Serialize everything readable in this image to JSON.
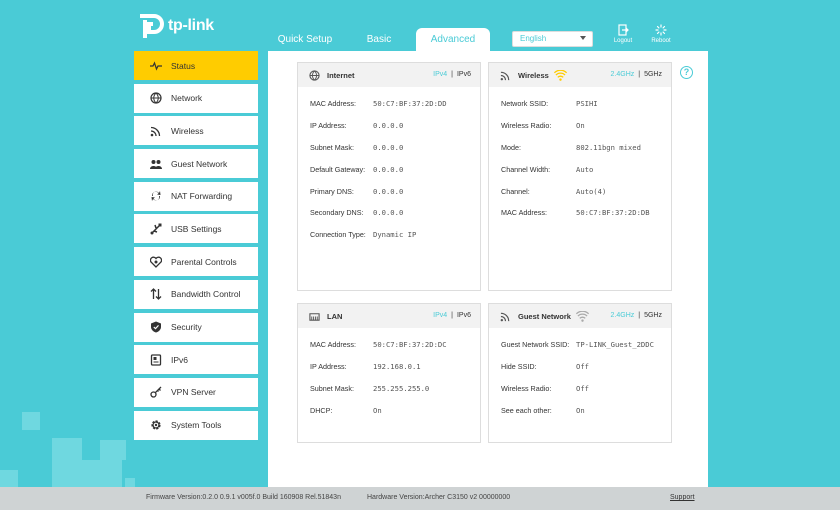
{
  "brand": {
    "logo_text": "tp-link"
  },
  "topnav": {
    "tabs": [
      "Quick Setup",
      "Basic",
      "Advanced"
    ],
    "language": "English",
    "logout_label": "Logout",
    "reboot_label": "Reboot"
  },
  "sidebar": {
    "items": [
      {
        "label": "Status"
      },
      {
        "label": "Network"
      },
      {
        "label": "Wireless"
      },
      {
        "label": "Guest Network"
      },
      {
        "label": "NAT Forwarding"
      },
      {
        "label": "USB Settings"
      },
      {
        "label": "Parental Controls"
      },
      {
        "label": "Bandwidth Control"
      },
      {
        "label": "Security"
      },
      {
        "label": "IPv6"
      },
      {
        "label": "VPN Server"
      },
      {
        "label": "System Tools"
      }
    ]
  },
  "internet": {
    "title": "Internet",
    "switch_a": "IPv4",
    "switch_b": "IPv6",
    "rows": [
      {
        "k": "MAC Address:",
        "v": "50:C7:BF:37:2D:DD"
      },
      {
        "k": "IP Address:",
        "v": "0.0.0.0"
      },
      {
        "k": "Subnet Mask:",
        "v": "0.0.0.0"
      },
      {
        "k": "Default Gateway:",
        "v": "0.0.0.0"
      },
      {
        "k": "Primary DNS:",
        "v": "0.0.0.0"
      },
      {
        "k": "Secondary DNS:",
        "v": "0.0.0.0"
      },
      {
        "k": "Connection Type:",
        "v": "Dynamic IP"
      }
    ]
  },
  "wireless": {
    "title": "Wireless",
    "switch_a": "2.4GHz",
    "switch_b": "5GHz",
    "rows": [
      {
        "k": "Network SSID:",
        "v": "PSIHI"
      },
      {
        "k": "Wireless Radio:",
        "v": "On"
      },
      {
        "k": "Mode:",
        "v": "802.11bgn mixed"
      },
      {
        "k": "Channel Width:",
        "v": "Auto"
      },
      {
        "k": "Channel:",
        "v": "Auto(4)"
      },
      {
        "k": "MAC Address:",
        "v": "50:C7:BF:37:2D:DB"
      }
    ]
  },
  "lan": {
    "title": "LAN",
    "switch_a": "IPv4",
    "switch_b": "IPv6",
    "rows": [
      {
        "k": "MAC Address:",
        "v": "50:C7:BF:37:2D:DC"
      },
      {
        "k": "IP Address:",
        "v": "192.168.0.1"
      },
      {
        "k": "Subnet Mask:",
        "v": "255.255.255.0"
      },
      {
        "k": "DHCP:",
        "v": "On"
      }
    ]
  },
  "guest": {
    "title": "Guest Network",
    "switch_a": "2.4GHz",
    "switch_b": "5GHz",
    "rows": [
      {
        "k": "Guest Network SSID:",
        "v": "TP-LINK_Guest_2DDC"
      },
      {
        "k": "Hide SSID:",
        "v": "Off"
      },
      {
        "k": "Wireless Radio:",
        "v": "Off"
      },
      {
        "k": "See each other:",
        "v": "On"
      }
    ]
  },
  "help_label": "?",
  "footer": {
    "firmware": "Firmware Version:0.2.0 0.9.1 v005f.0 Build 160908 Rel.51843n",
    "hardware": "Hardware Version:Archer C3150 v2 00000000",
    "support": "Support"
  },
  "colors": {
    "accent": "#4acbd6",
    "active": "#ffcc00",
    "wifi_icon": "#ffcc00"
  }
}
